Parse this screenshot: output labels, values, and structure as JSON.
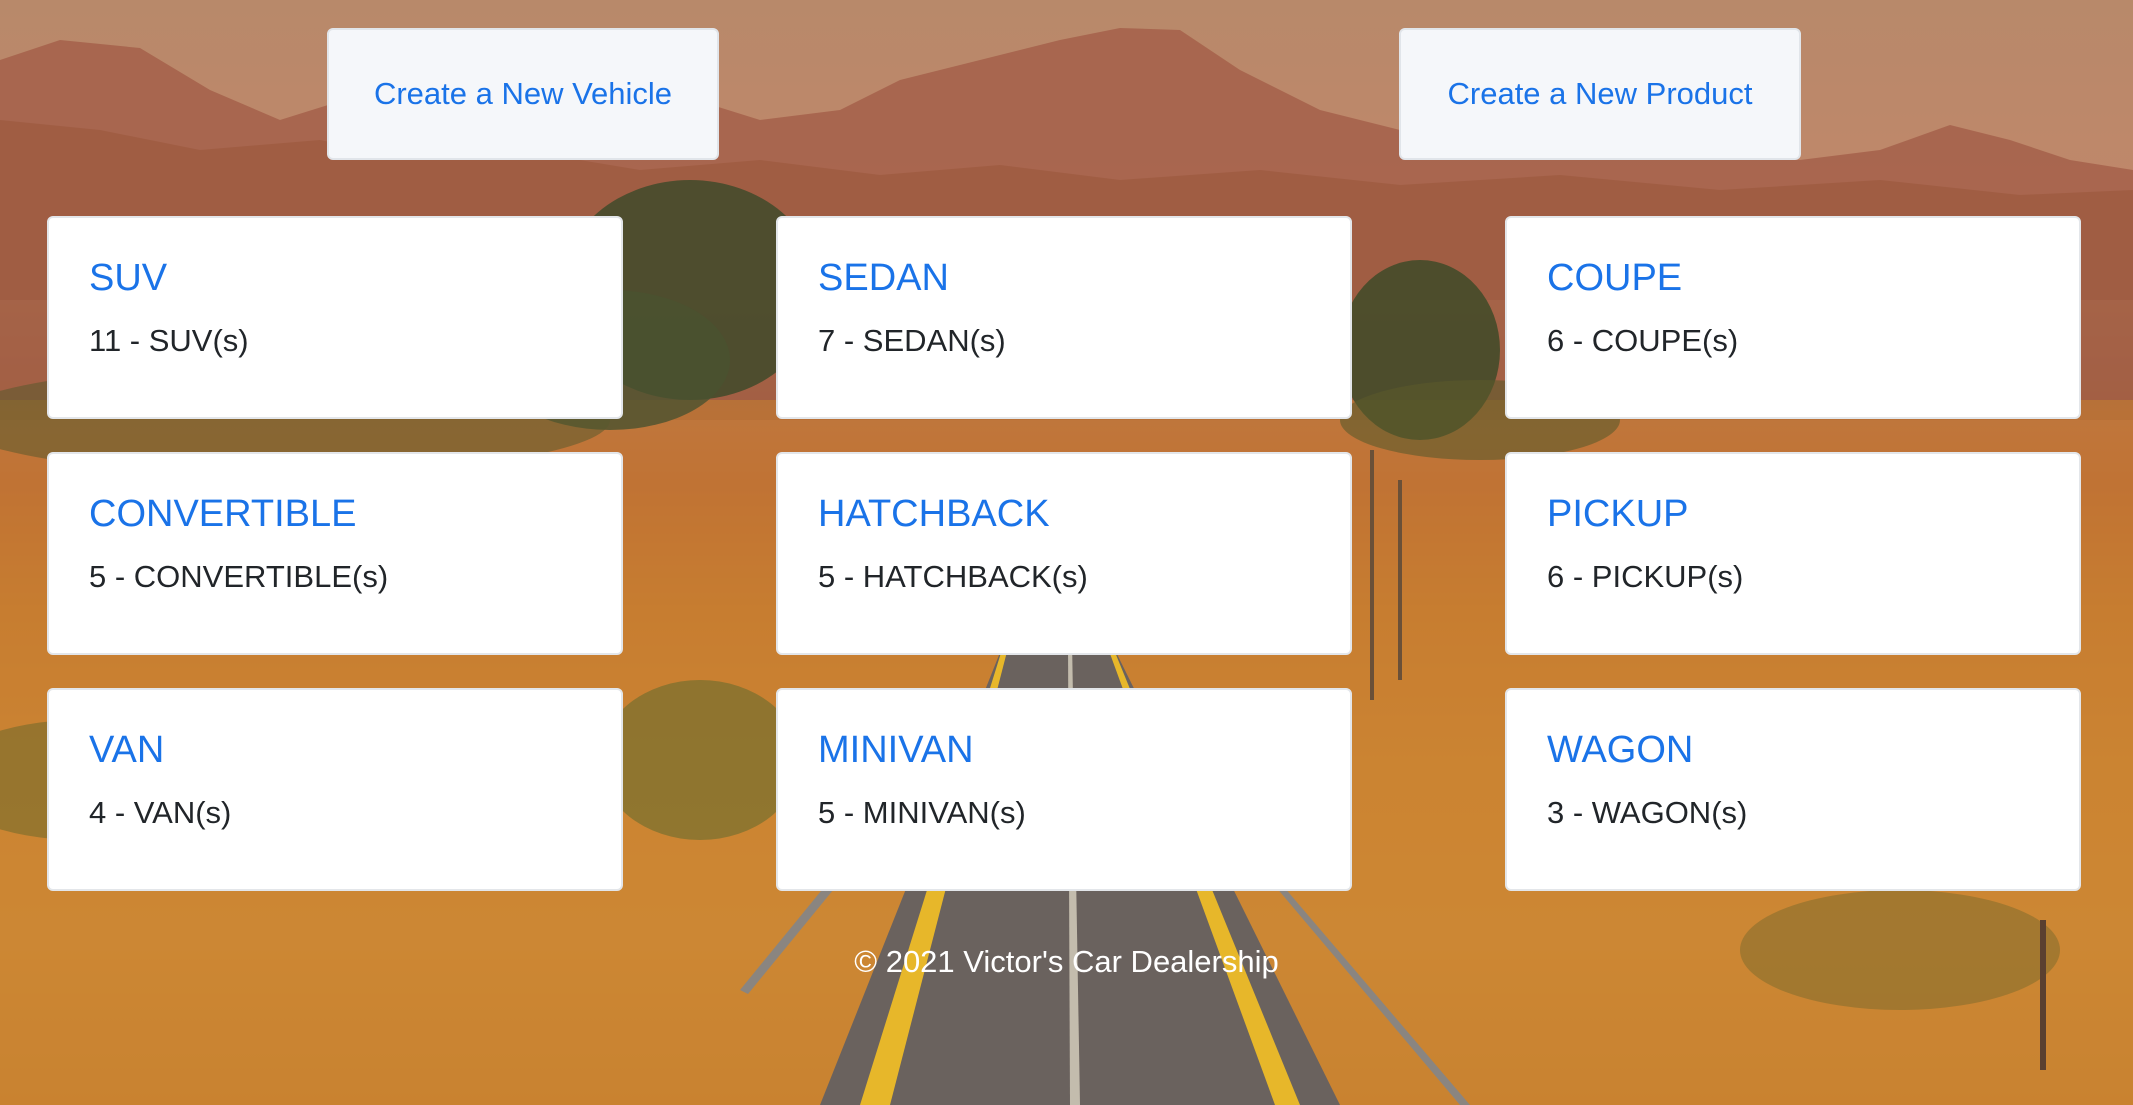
{
  "actions": {
    "create_vehicle": "Create a New Vehicle",
    "create_product": "Create a New Product"
  },
  "categories": [
    {
      "title": "SUV",
      "count": "11 - SUV(s)"
    },
    {
      "title": "SEDAN",
      "count": "7 - SEDAN(s)"
    },
    {
      "title": "COUPE",
      "count": "6 - COUPE(s)"
    },
    {
      "title": "CONVERTIBLE",
      "count": "5 - CONVERTIBLE(s)"
    },
    {
      "title": "HATCHBACK",
      "count": "5 - HATCHBACK(s)"
    },
    {
      "title": "PICKUP",
      "count": "6 - PICKUP(s)"
    },
    {
      "title": "VAN",
      "count": "4 - VAN(s)"
    },
    {
      "title": "MINIVAN",
      "count": "5 - MINIVAN(s)"
    },
    {
      "title": "WAGON",
      "count": "3 - WAGON(s)"
    }
  ],
  "footer": {
    "text": "© 2021 Victor's Car Dealership"
  },
  "colors": {
    "link_blue": "#1a73e8",
    "card_bg": "#ffffff",
    "button_bg": "#f5f7fa",
    "footer_text": "#ffffff"
  },
  "background": {
    "image": "desert-road-landscape"
  }
}
